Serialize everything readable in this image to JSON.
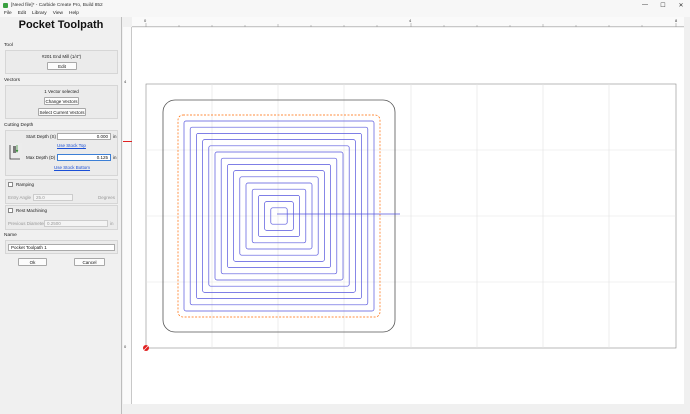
{
  "window": {
    "title": "[Need file]* - Carbide Create Pro, Build 852",
    "min_glyph": "—",
    "max_glyph": "☐",
    "close_glyph": "✕"
  },
  "menu": [
    "File",
    "Edit",
    "Library",
    "View",
    "Help"
  ],
  "panel": {
    "title": "Pocket Toolpath",
    "tool": {
      "section": "Tool",
      "name": "#201 End Mill (1/4\")",
      "edit_label": "Edit"
    },
    "vectors": {
      "section": "Vectors",
      "selected_text": "1 Vector selected",
      "change_label": "Change Vectors",
      "select_current_label": "Select Current Vectors"
    },
    "cutting_depth": {
      "section": "Cutting Depth",
      "start_label": "Start Depth (S)",
      "start_value": "0.000",
      "start_unit": "in",
      "use_stock_top": "Use Stock Top",
      "max_label": "Max Depth (D)",
      "max_value": "0.125",
      "max_unit": "in",
      "use_stock_bottom": "Use Stock Bottom"
    },
    "ramping": {
      "label": "Ramping",
      "entry_angle_label": "Entry Angle",
      "entry_angle_value": "25.0",
      "entry_angle_unit": "Degrees"
    },
    "rest_machining": {
      "label": "Rest Machining",
      "prev_diameter_label": "Previous Diameter",
      "prev_diameter_value": "0.2500",
      "prev_diameter_unit": "in"
    },
    "name": {
      "section": "Name",
      "value": "Pocket Toolpath 1"
    },
    "ok_label": "Ok",
    "cancel_label": "Cancel"
  },
  "rulers": {
    "h_ticks": [
      "0",
      "4",
      "8"
    ],
    "v_ticks": [
      "4",
      "0"
    ]
  },
  "colors": {
    "toolpath": "#5555dd",
    "offset": "#ff6a00",
    "outline": "#555555",
    "grid": "#e2e2e2",
    "ruler_marker": "#e02020"
  }
}
